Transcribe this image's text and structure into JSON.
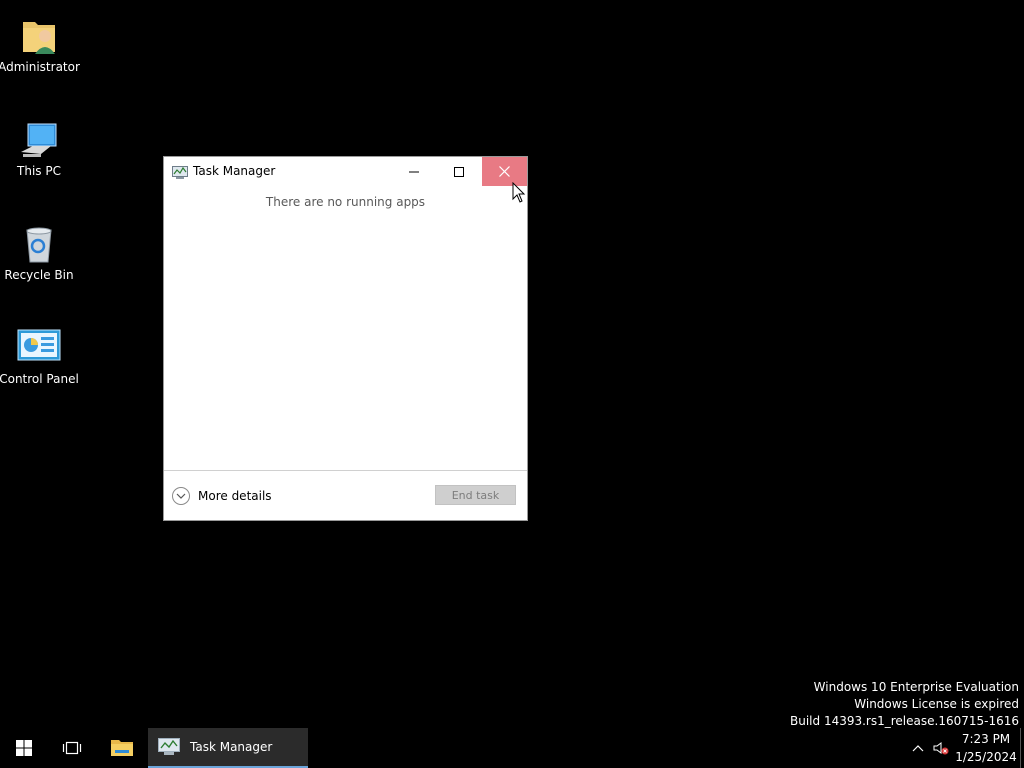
{
  "desktop": {
    "icons": [
      {
        "label": "Administrator",
        "icon": "user-folder-icon"
      },
      {
        "label": "This PC",
        "icon": "computer-icon"
      },
      {
        "label": "Recycle Bin",
        "icon": "recycle-bin-icon"
      },
      {
        "label": "Control Panel",
        "icon": "control-panel-icon"
      }
    ]
  },
  "window": {
    "title": "Task Manager",
    "empty_message": "There are no running apps",
    "more_details_label": "More details",
    "end_task_label": "End task",
    "close_hover_color": "#e87a84"
  },
  "watermark": {
    "line1": "Windows 10 Enterprise Evaluation",
    "line2": "Windows License is expired",
    "line3": "Build 14393.rs1_release.160715-1616"
  },
  "taskbar": {
    "active_task_label": "Task Manager",
    "time": "7:23 PM",
    "date": "1/25/2024",
    "accent_color": "#6aa4d9"
  }
}
